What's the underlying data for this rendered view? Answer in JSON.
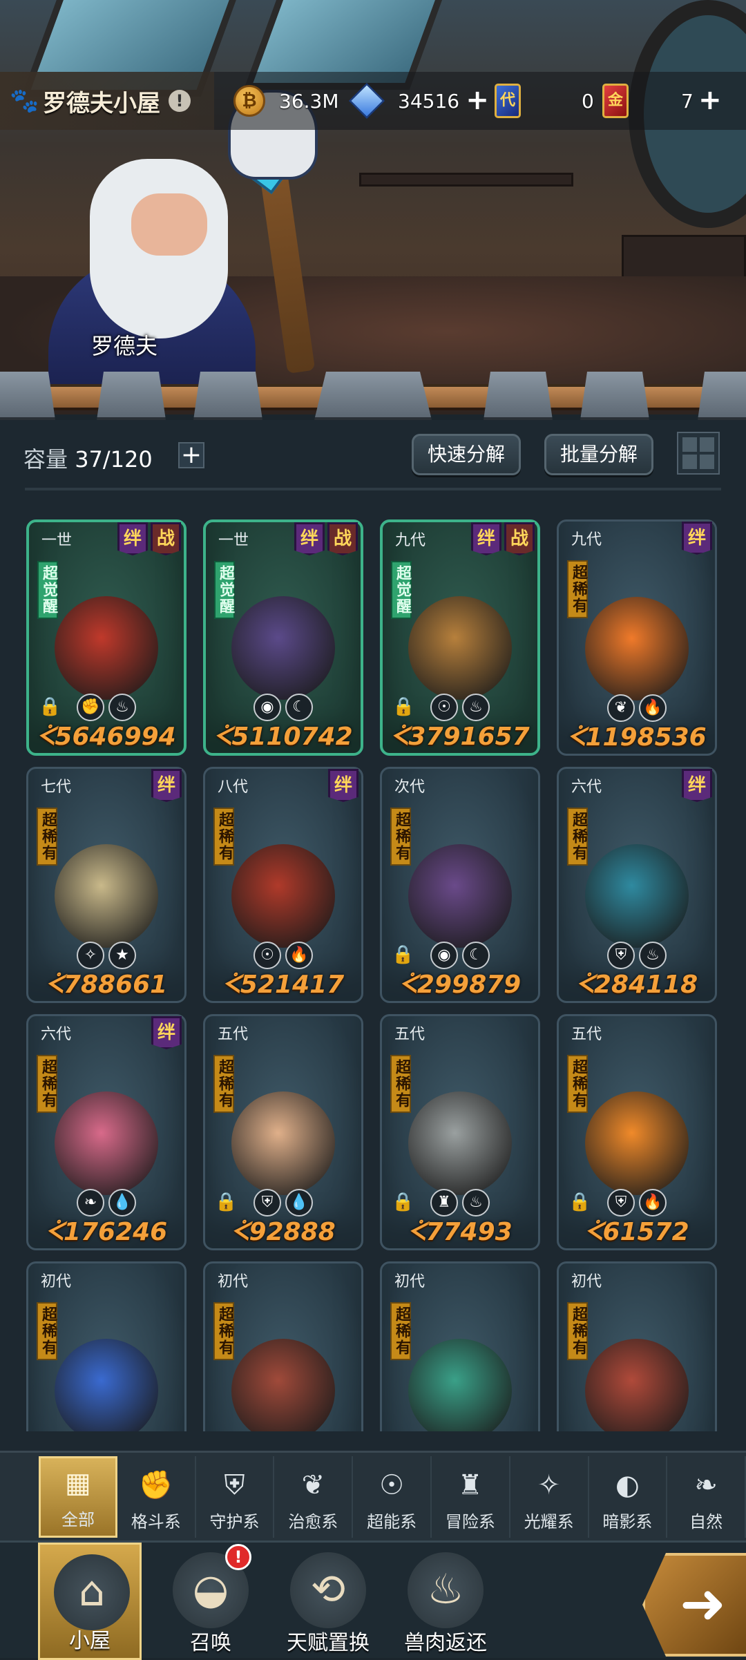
{
  "header": {
    "house_title": "罗德夫小屋",
    "info_icon": "!",
    "npc_name": "罗德夫",
    "resources": {
      "gold": "36.3M",
      "crystal": "34516",
      "blue_ticket_icon": "代",
      "blue_ticket": "0",
      "red_ticket_icon": "金",
      "red_ticket": "7"
    }
  },
  "capacity": {
    "label": "容量",
    "value": "37/120"
  },
  "buttons": {
    "quick_decompose": "快速分解",
    "batch_decompose": "批量分解"
  },
  "cards": [
    {
      "gen": "一世",
      "rarity": "超觉醒",
      "awake": true,
      "bond": "绊",
      "fight": "战",
      "locked": true,
      "elements": [
        "fist-icon",
        "meat-icon"
      ],
      "power": "5646994",
      "color": "#c0392b"
    },
    {
      "gen": "一世",
      "rarity": "超觉醒",
      "awake": true,
      "bond": "绊",
      "fight": "战",
      "locked": false,
      "elements": [
        "eye-icon",
        "moon-icon"
      ],
      "power": "5110742",
      "color": "#5b4a8a"
    },
    {
      "gen": "九代",
      "rarity": "超觉醒",
      "awake": true,
      "bond": "绊",
      "fight": "战",
      "locked": true,
      "elements": [
        "alien-icon",
        "meat-icon"
      ],
      "power": "3791657",
      "color": "#b7803c"
    },
    {
      "gen": "九代",
      "rarity": "超稀有",
      "awake": false,
      "bond": "绊",
      "fight": "",
      "locked": false,
      "elements": [
        "sprout-icon",
        "fire-icon"
      ],
      "power": "1198536",
      "color": "#f07a2a"
    },
    {
      "gen": "七代",
      "rarity": "超稀有",
      "awake": false,
      "bond": "绊",
      "fight": "",
      "locked": false,
      "elements": [
        "sparkle-icon",
        "star-icon"
      ],
      "power": "788661",
      "color": "#c9b98a"
    },
    {
      "gen": "八代",
      "rarity": "超稀有",
      "awake": false,
      "bond": "绊",
      "fight": "",
      "locked": false,
      "elements": [
        "alien-icon",
        "fire-icon"
      ],
      "power": "521417",
      "color": "#b03a2a"
    },
    {
      "gen": "次代",
      "rarity": "超稀有",
      "awake": false,
      "bond": "",
      "fight": "",
      "locked": true,
      "elements": [
        "eye-icon",
        "moon-icon"
      ],
      "power": "299879",
      "color": "#6a4a8a"
    },
    {
      "gen": "六代",
      "rarity": "超稀有",
      "awake": false,
      "bond": "绊",
      "fight": "",
      "locked": false,
      "elements": [
        "shield-icon",
        "meat-icon"
      ],
      "power": "284118",
      "color": "#2f8aa0"
    },
    {
      "gen": "六代",
      "rarity": "超稀有",
      "awake": false,
      "bond": "绊",
      "fight": "",
      "locked": false,
      "elements": [
        "leaf-icon",
        "water-icon"
      ],
      "power": "176246",
      "color": "#d86a8a"
    },
    {
      "gen": "五代",
      "rarity": "超稀有",
      "awake": false,
      "bond": "",
      "fight": "",
      "locked": true,
      "elements": [
        "shield-icon",
        "water-icon"
      ],
      "power": "92888",
      "color": "#e0b08a"
    },
    {
      "gen": "五代",
      "rarity": "超稀有",
      "awake": false,
      "bond": "",
      "fight": "",
      "locked": true,
      "elements": [
        "tower-icon",
        "meat-icon"
      ],
      "power": "77493",
      "color": "#9aa0a0"
    },
    {
      "gen": "五代",
      "rarity": "超稀有",
      "awake": false,
      "bond": "",
      "fight": "",
      "locked": true,
      "elements": [
        "shield-icon",
        "fire-icon"
      ],
      "power": "61572",
      "color": "#f08a2a"
    },
    {
      "gen": "初代",
      "rarity": "超稀有",
      "awake": false,
      "bond": "",
      "fight": "",
      "locked": false,
      "elements": [],
      "power": "",
      "color": "#3a6ad0"
    },
    {
      "gen": "初代",
      "rarity": "超稀有",
      "awake": false,
      "bond": "",
      "fight": "",
      "locked": false,
      "elements": [],
      "power": "",
      "color": "#a04a3a"
    },
    {
      "gen": "初代",
      "rarity": "超稀有",
      "awake": false,
      "bond": "",
      "fight": "",
      "locked": false,
      "elements": [],
      "power": "",
      "color": "#3aa088"
    },
    {
      "gen": "初代",
      "rarity": "超稀有",
      "awake": false,
      "bond": "",
      "fight": "",
      "locked": false,
      "elements": [],
      "power": "",
      "color": "#b04a3a"
    }
  ],
  "filter_tabs": [
    {
      "label": "全部",
      "icon": "▦",
      "active": true
    },
    {
      "label": "格斗系",
      "icon": "✊",
      "active": false
    },
    {
      "label": "守护系",
      "icon": "⛨",
      "active": false
    },
    {
      "label": "治愈系",
      "icon": "❦",
      "active": false
    },
    {
      "label": "超能系",
      "icon": "☉",
      "active": false
    },
    {
      "label": "冒险系",
      "icon": "♜",
      "active": false
    },
    {
      "label": "光耀系",
      "icon": "✧",
      "active": false
    },
    {
      "label": "暗影系",
      "icon": "◐",
      "active": false
    },
    {
      "label": "自然",
      "icon": "❧",
      "active": false
    }
  ],
  "nav": [
    {
      "label": "小屋",
      "icon": "⌂",
      "active": true,
      "badge": ""
    },
    {
      "label": "召唤",
      "icon": "◒",
      "active": false,
      "badge": "!"
    },
    {
      "label": "天赋置换",
      "icon": "⟲",
      "active": false,
      "badge": ""
    },
    {
      "label": "兽肉返还",
      "icon": "♨",
      "active": false,
      "badge": ""
    }
  ],
  "next_arrow": "➜"
}
